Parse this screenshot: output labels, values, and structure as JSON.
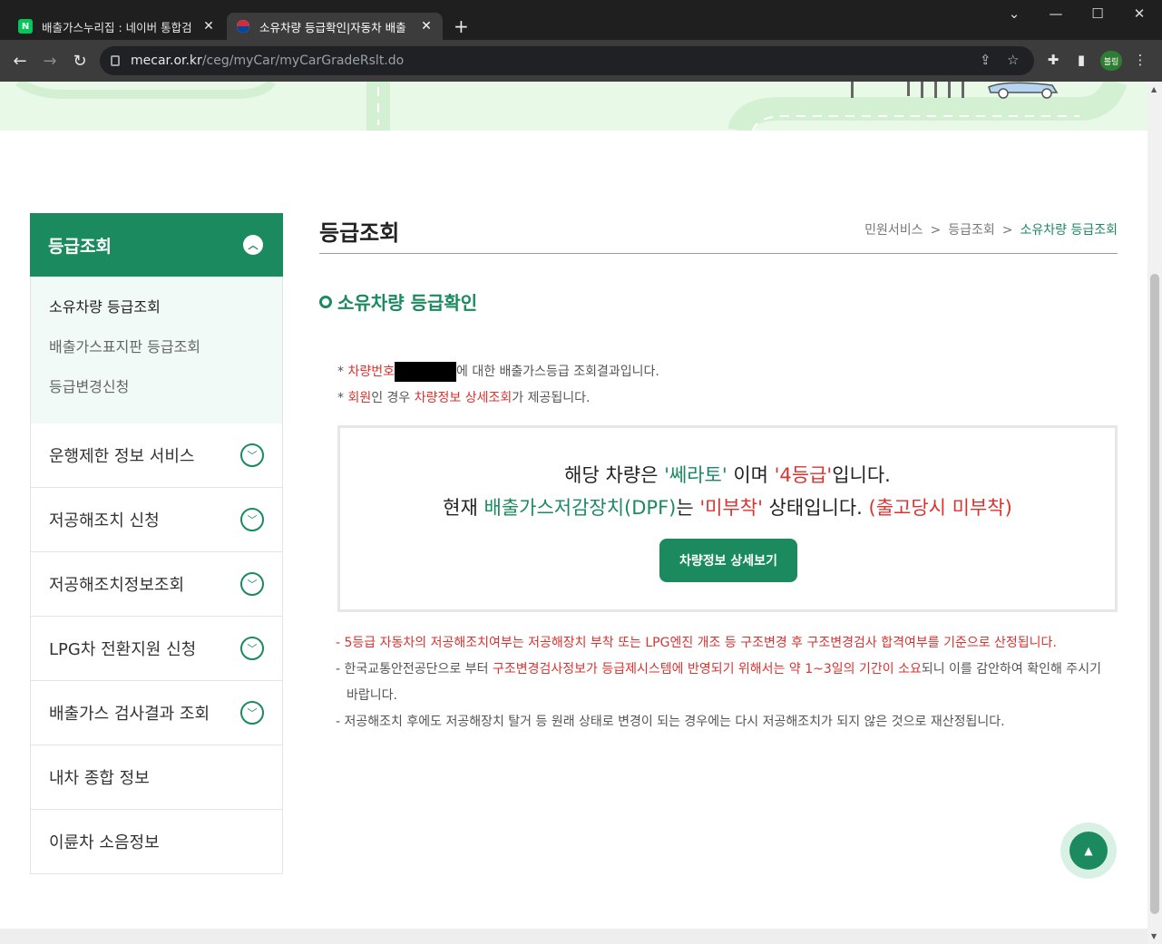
{
  "browser": {
    "tabs": [
      {
        "favicon": "N",
        "title": "배출가스누리집 : 네이버 통합검"
      },
      {
        "favicon": "",
        "title": "소유차량 등급확인|자동차 배출"
      }
    ],
    "close_glyph": "✕",
    "new_tab": "+",
    "url_host": "mecar.or.kr",
    "url_path": "/ceg/myCar/myCarGradeRslt.do",
    "profile": "볼링",
    "window_controls": [
      "⌄",
      "—",
      "☐",
      "✕"
    ]
  },
  "sidebar": {
    "header": "등급조회",
    "sub_items": [
      "소유차량 등급조회",
      "배출가스표지판 등급조회",
      "등급변경신청"
    ],
    "items": [
      {
        "label": "운행제한 정보 서비스",
        "has_toggle": true
      },
      {
        "label": "저공해조치 신청",
        "has_toggle": true
      },
      {
        "label": "저공해조치정보조회",
        "has_toggle": true
      },
      {
        "label": "LPG차 전환지원 신청",
        "has_toggle": true
      },
      {
        "label": "배출가스 검사결과 조회",
        "has_toggle": true
      },
      {
        "label": "내차 종합 정보",
        "has_toggle": false
      },
      {
        "label": "이륜차 소음정보",
        "has_toggle": false
      }
    ]
  },
  "main": {
    "title": "등급조회",
    "breadcrumb": [
      "민원서비스",
      "등급조회",
      "소유차량 등급조회"
    ],
    "breadcrumb_sep": ">",
    "section_title": "소유차량 등급확인",
    "note1": {
      "star": "* ",
      "red": "차량번호",
      "rest": "에 대한 배출가스등급 조회결과입니다."
    },
    "note2": {
      "star": "* ",
      "red1": "회원",
      "mid": "인 경우 ",
      "red2": "차량정보 상세조회",
      "rest": "가 제공됩니다."
    },
    "result": {
      "l1_a": "해당 차량은 ",
      "l1_model": "'쎄라토'",
      "l1_b": " 이며 ",
      "l1_grade": "'4등급'",
      "l1_c": "입니다.",
      "l2_a": "현재 ",
      "l2_dpf": "배출가스저감장치(DPF)",
      "l2_b": "는 ",
      "l2_status": "'미부착'",
      "l2_c": " 상태입니다. ",
      "l2_orig": "(출고당시 미부착)",
      "button": "차량정보 상세보기"
    },
    "foot": {
      "f1": "- 5등급 자동차의 저공해조치여부는 저공해장치 부착 또는 LPG엔진 개조 등 구조변경 후 구조변경검사 합격여부를 기준으로 산정됩니다.",
      "f2_a": "- 한국교통안전공단으로 부터 ",
      "f2_red": "구조변경검사정보가 등급제시스템에 반영되기 위해서는 약 1~3일의 기간이 소요",
      "f2_b": "되니 이를 감안하여 확인해 주시기 바랍니다.",
      "f3": "- 저공해조치 후에도 저공해장치 탈거 등 원래 상태로 변경이 되는 경우에는 다시 저공해조치가 되지 않은 것으로 재산정됩니다."
    }
  },
  "colors": {
    "brand_green": "#1b8a5f",
    "red": "#d9332f",
    "hero_bg": "#e8f9e7"
  }
}
